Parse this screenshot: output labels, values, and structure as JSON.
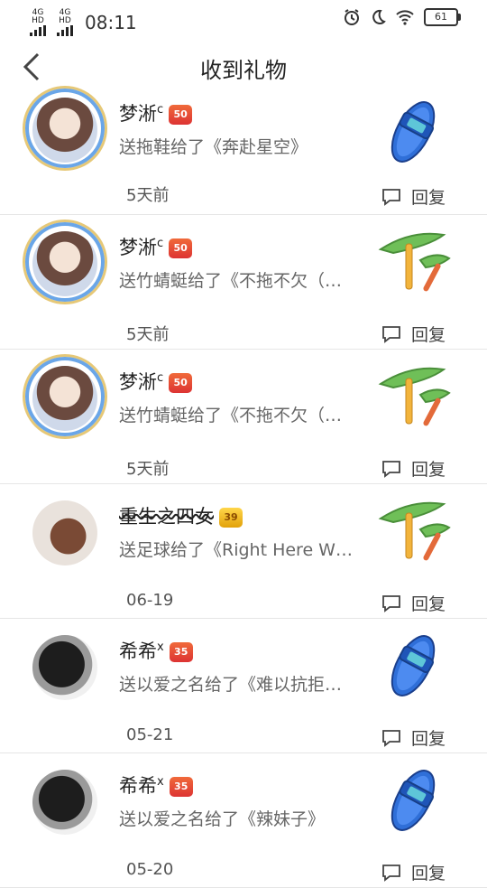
{
  "status_bar": {
    "net1": "4G HD",
    "net2": "4G HD",
    "time": "08:11",
    "battery": "61"
  },
  "header": {
    "title": "收到礼物"
  },
  "colors": {
    "frame_blue": "#6aa6e8",
    "frame_gold": "#e6c877",
    "divider": "#e6e6e6"
  },
  "items": [
    {
      "name": "梦淅",
      "sup": "c",
      "level": "50",
      "badge": "red",
      "text": "送拖鞋给了《奔赴星空》",
      "time": "5天前",
      "reply": "回复",
      "gift": "slipper-icon",
      "avatar": "framed"
    },
    {
      "name": "梦淅",
      "sup": "c",
      "level": "50",
      "badge": "red",
      "text": "送竹蜻蜓给了《不拖不欠（…",
      "time": "5天前",
      "reply": "回复",
      "gift": "bamboo-dragonfly-icon",
      "avatar": "framed"
    },
    {
      "name": "梦淅",
      "sup": "c",
      "level": "50",
      "badge": "red",
      "text": "送竹蜻蜓给了《不拖不欠（…",
      "time": "5天前",
      "reply": "回复",
      "gift": "bamboo-dragonfly-icon",
      "avatar": "framed"
    },
    {
      "name": "重生之四女",
      "sup": "",
      "level": "39",
      "badge": "gold",
      "text": "送足球给了《Right Here W…",
      "time": "06-19",
      "reply": "回复",
      "gift": "bamboo-dragonfly-icon",
      "avatar": "plain"
    },
    {
      "name": "希希",
      "sup": "x",
      "level": "35",
      "badge": "red",
      "text": "送以爱之名给了《难以抗拒…",
      "time": "05-21",
      "reply": "回复",
      "gift": "slipper-icon",
      "avatar": "plain"
    },
    {
      "name": "希希",
      "sup": "x",
      "level": "35",
      "badge": "red",
      "text": "送以爱之名给了《辣妹子》",
      "time": "05-20",
      "reply": "回复",
      "gift": "slipper-icon",
      "avatar": "plain"
    }
  ]
}
